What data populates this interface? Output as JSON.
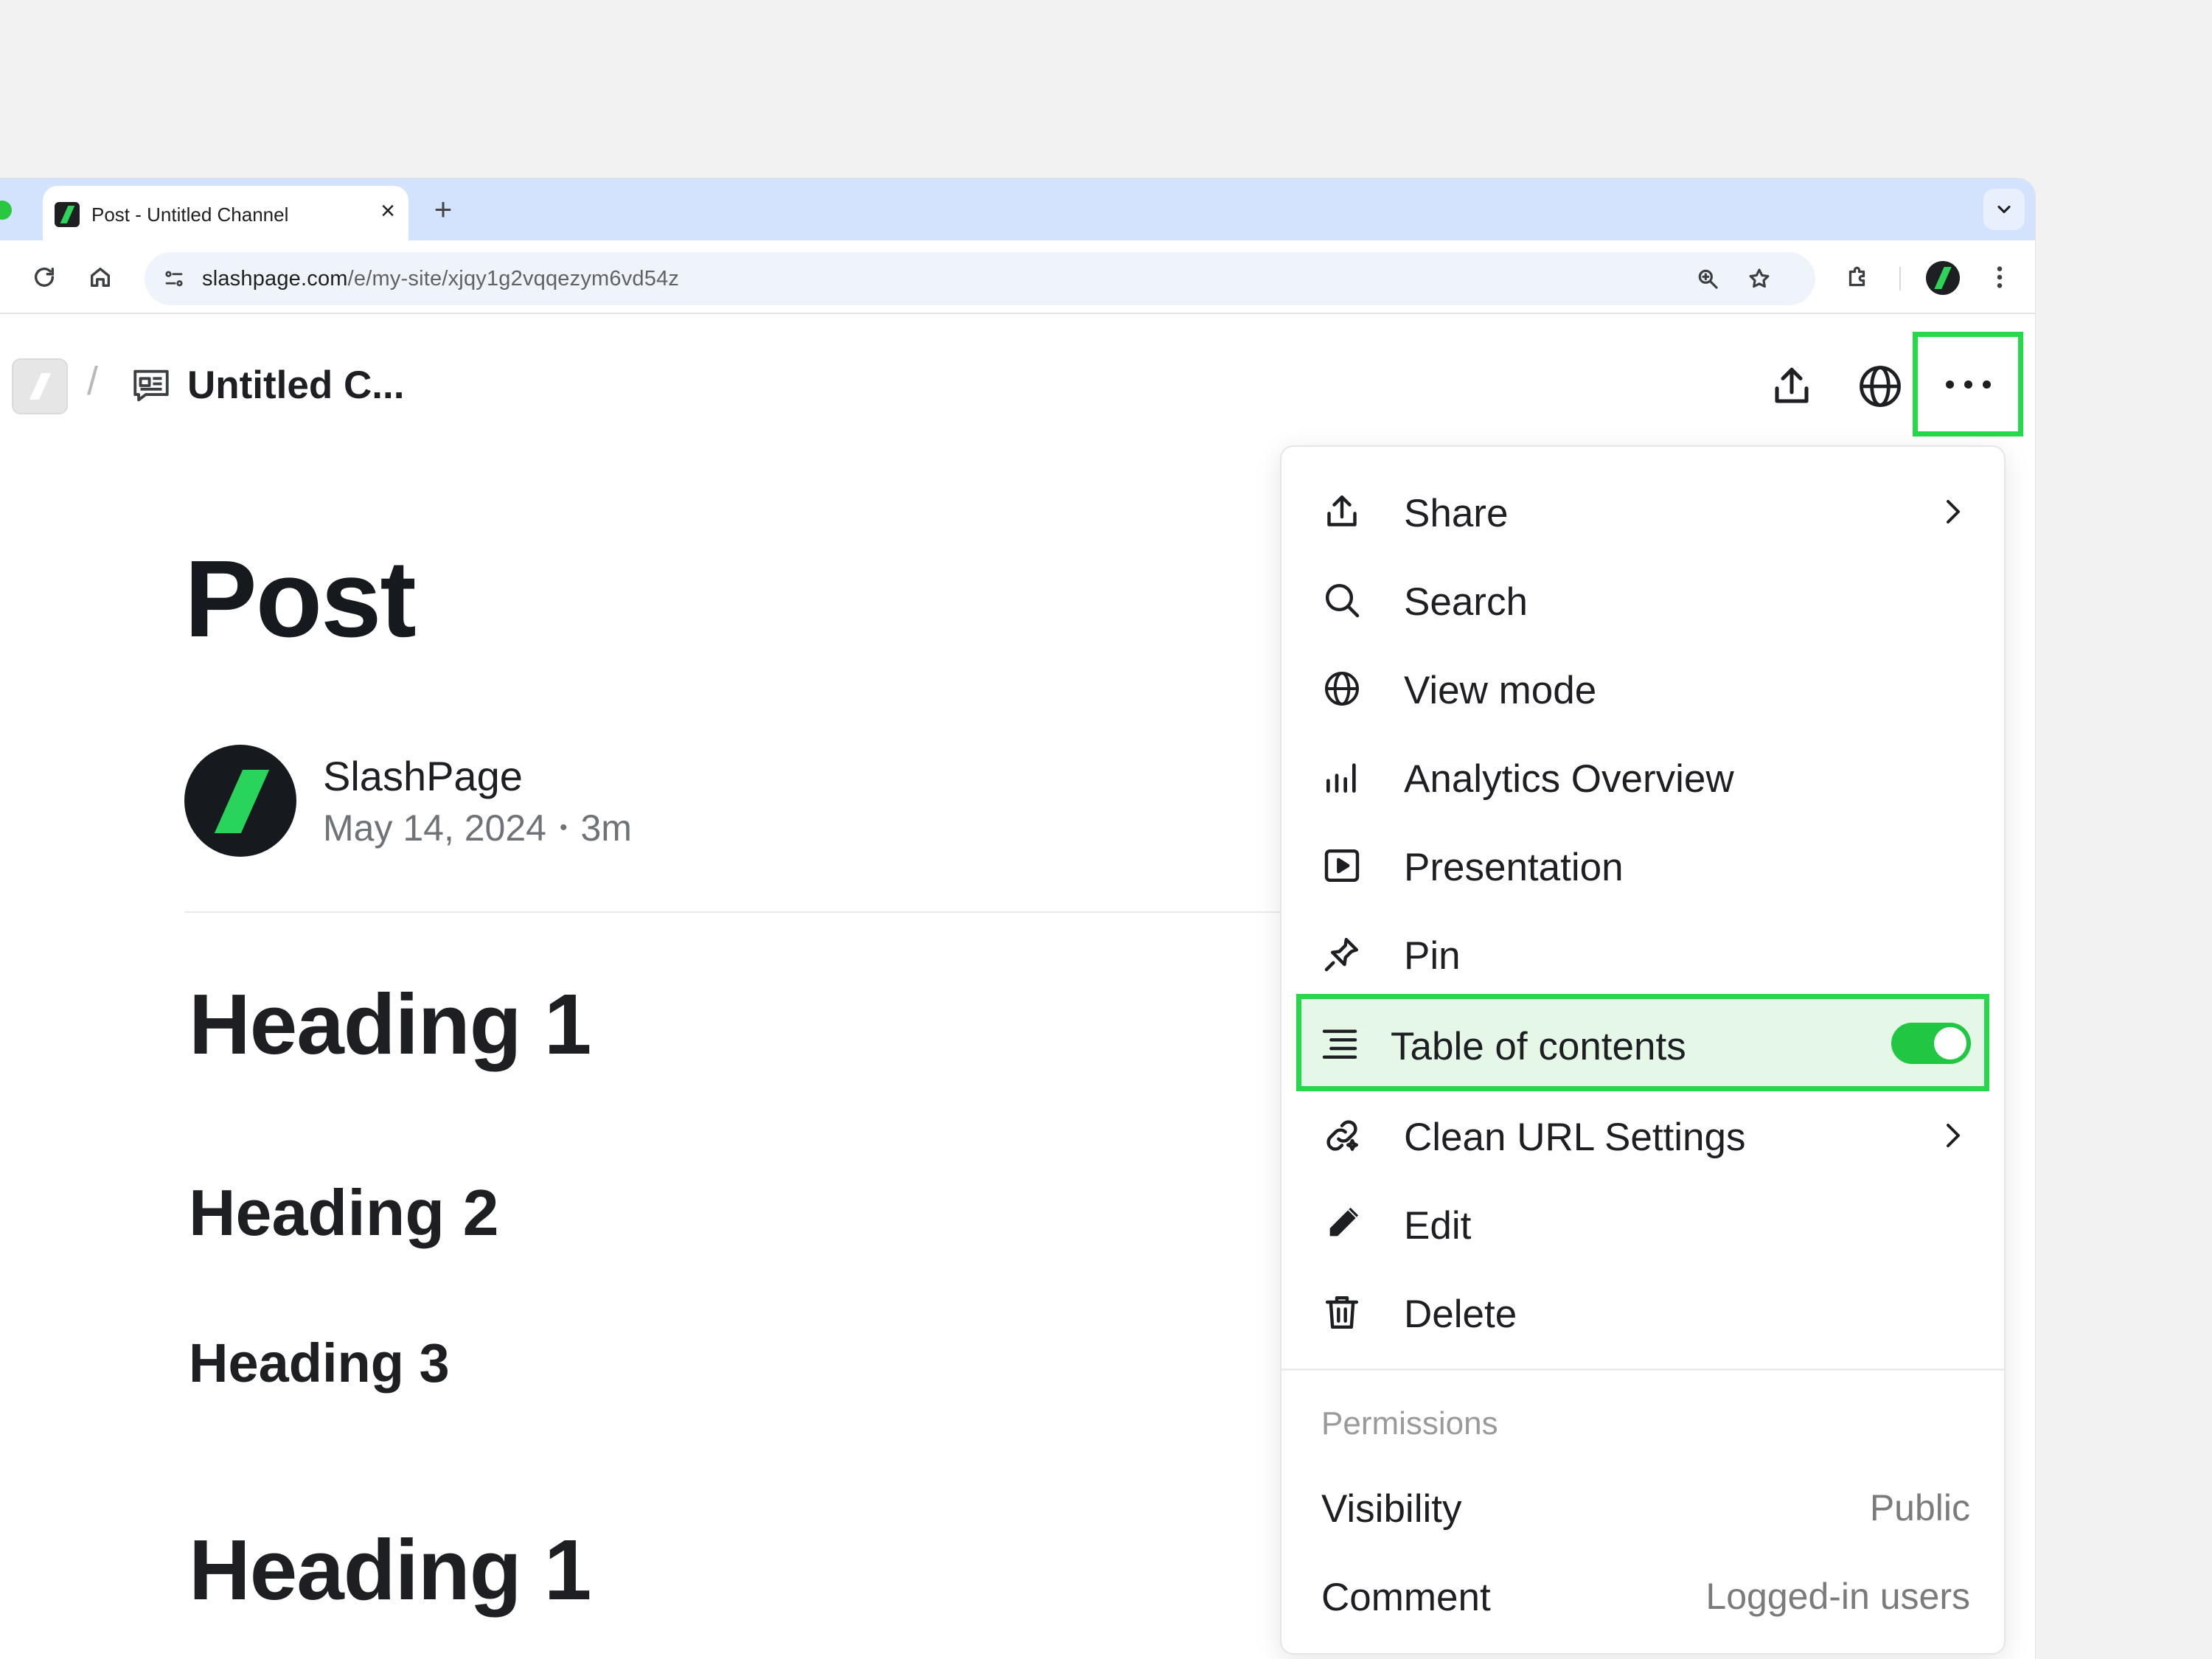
{
  "browser": {
    "tab_title": "Post - Untitled Channel",
    "tab_close": "×",
    "new_tab": "+",
    "url_host": "slashpage.com",
    "url_path": "/e/my-site/xjqy1g2vqqezym6vd54z"
  },
  "header": {
    "breadcrumb_separator": "/",
    "channel_title": "Untitled C..."
  },
  "post": {
    "title": "Post",
    "author": "SlashPage",
    "date": "May 14, 2024",
    "meta_separator": "•",
    "read_time": "3m",
    "headings": [
      {
        "level": 1,
        "text": "Heading 1"
      },
      {
        "level": 2,
        "text": "Heading 2"
      },
      {
        "level": 3,
        "text": "Heading 3"
      },
      {
        "level": 1,
        "text": "Heading 1"
      }
    ]
  },
  "menu": {
    "items": [
      {
        "label": "Share",
        "icon": "share-icon",
        "has_submenu": true
      },
      {
        "label": "Search",
        "icon": "search-icon"
      },
      {
        "label": "View mode",
        "icon": "globe-icon"
      },
      {
        "label": "Analytics Overview",
        "icon": "analytics-icon"
      },
      {
        "label": "Presentation",
        "icon": "presentation-icon"
      },
      {
        "label": "Pin",
        "icon": "pin-icon"
      },
      {
        "label": "Table of contents",
        "icon": "table-of-contents-icon",
        "toggle": true,
        "enabled": true
      },
      {
        "label": "Clean URL Settings",
        "icon": "link-magic-icon",
        "has_submenu": true
      },
      {
        "label": "Edit",
        "icon": "pencil-icon"
      },
      {
        "label": "Delete",
        "icon": "trash-icon"
      }
    ],
    "permissions_label": "Permissions",
    "permissions": [
      {
        "key": "Visibility",
        "value": "Public"
      },
      {
        "key": "Comment",
        "value": "Logged-in users"
      }
    ]
  },
  "colors": {
    "accent_green": "#27d84a",
    "toggle_on": "#21c743",
    "highlight_bg": "#e5f8e8",
    "tabstrip": "#d3e3fd"
  }
}
